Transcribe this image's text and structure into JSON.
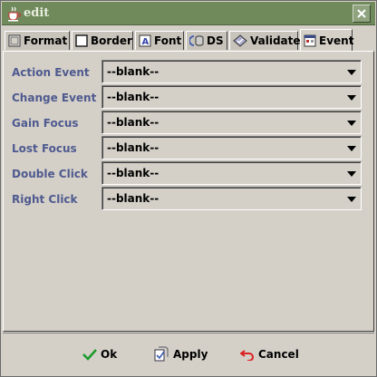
{
  "window": {
    "title": "edit"
  },
  "tabs": [
    {
      "label": "Format",
      "icon": "format-icon"
    },
    {
      "label": "Border",
      "icon": "border-icon"
    },
    {
      "label": "Font",
      "icon": "font-icon"
    },
    {
      "label": "DS",
      "icon": "datasource-icon"
    },
    {
      "label": "Validate",
      "icon": "validate-icon"
    },
    {
      "label": "Event",
      "icon": "event-icon",
      "active": true
    }
  ],
  "events": [
    {
      "label": "Action Event",
      "value": "--blank--"
    },
    {
      "label": "Change Event",
      "value": "--blank--"
    },
    {
      "label": "Gain Focus",
      "value": "--blank--"
    },
    {
      "label": "Lost Focus",
      "value": "--blank--"
    },
    {
      "label": "Double Click",
      "value": "--blank--"
    },
    {
      "label": "Right Click",
      "value": "--blank--"
    }
  ],
  "buttons": {
    "ok": "Ok",
    "apply": "Apply",
    "cancel": "Cancel"
  },
  "colors": {
    "titlebar": "#708a5c",
    "label": "#4f5a8f",
    "face": "#d4d0c8"
  }
}
